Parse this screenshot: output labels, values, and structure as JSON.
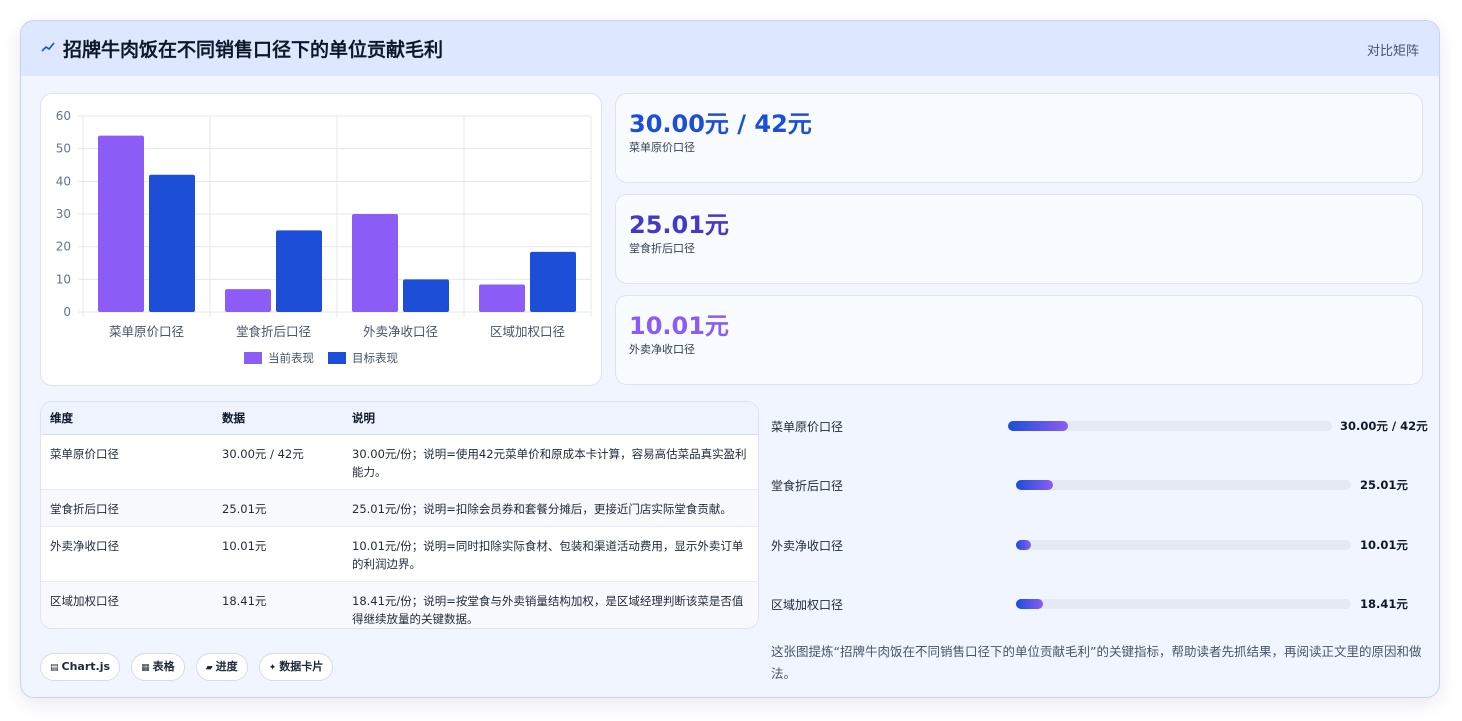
{
  "header": {
    "title": "招牌牛肉饭在不同销售口径下的单位贡献毛利",
    "compare_link": "对比矩阵"
  },
  "chart_data": {
    "type": "bar",
    "categories": [
      "菜单原价口径",
      "堂食折后口径",
      "外卖净收口径",
      "区域加权口径"
    ],
    "series": [
      {
        "name": "当前表现",
        "values": [
          54,
          7,
          30,
          8.4
        ],
        "color": "#8b5cf6"
      },
      {
        "name": "目标表现",
        "values": [
          42,
          25,
          10,
          18.4
        ],
        "color": "#1d4ed8"
      }
    ],
    "ylim": [
      0,
      60
    ],
    "yticks": [
      0,
      10,
      20,
      30,
      40,
      50,
      60
    ],
    "grid": true,
    "legend_position": "bottom"
  },
  "stats": [
    {
      "value": "30.00元 / 42元",
      "label": "菜单原价口径",
      "color": "#1d4ed8"
    },
    {
      "value": "25.01元",
      "label": "堂食折后口径",
      "color": "#4338ca"
    },
    {
      "value": "10.01元",
      "label": "外卖净收口径",
      "color": "#8b5cf6"
    }
  ],
  "table": {
    "headers": [
      "维度",
      "数据",
      "说明"
    ],
    "rows": [
      [
        "菜单原价口径",
        "30.00元 / 42元",
        "30.00元/份；说明=使用42元菜单价和原成本卡计算，容易高估菜品真实盈利能力。"
      ],
      [
        "堂食折后口径",
        "25.01元",
        "25.01元/份；说明=扣除会员券和套餐分摊后，更接近门店实际堂食贡献。"
      ],
      [
        "外卖净收口径",
        "10.01元",
        "10.01元/份；说明=同时扣除实际食材、包装和渠道活动费用，显示外卖订单的利润边界。"
      ],
      [
        "区域加权口径",
        "18.41元",
        "18.41元/份；说明=按堂食与外卖销量结构加权，是区域经理判断该菜是否值得继续放量的关键数据。"
      ]
    ]
  },
  "progress": [
    {
      "label": "菜单原价口径",
      "value": "30.00元 / 42元",
      "fraction": 0.185
    },
    {
      "label": "堂食折后口径",
      "value": "25.01元",
      "fraction": 0.11
    },
    {
      "label": "外卖净收口径",
      "value": "10.01元",
      "fraction": 0.045
    },
    {
      "label": "区域加权口径",
      "value": "18.41元",
      "fraction": 0.08
    }
  ],
  "badges": [
    {
      "icon": "▤",
      "label": "Chart.js"
    },
    {
      "icon": "▦",
      "label": "表格"
    },
    {
      "icon": "▰",
      "label": "进度"
    },
    {
      "icon": "✦",
      "label": "数据卡片"
    }
  ],
  "summary": "这张图提炼“招牌牛肉饭在不同销售口径下的单位贡献毛利”的关键指标，帮助读者先抓结果，再阅读正文里的原因和做法。"
}
